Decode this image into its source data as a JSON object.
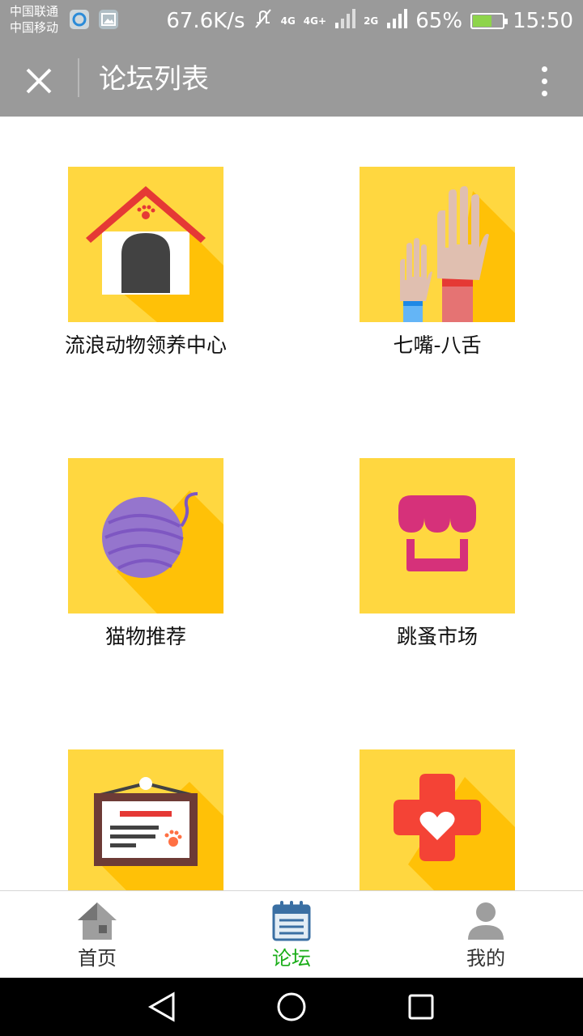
{
  "status_bar": {
    "carrier_1": "中国联通",
    "carrier_2": "中国移动",
    "speed": "67.6K/s",
    "net_4g": "4G",
    "net_4g_plus": "4G+",
    "net_2g": "2G",
    "battery": "65%",
    "battery_level": 0.65,
    "time": "15:50"
  },
  "app_bar": {
    "title": "论坛列表",
    "close_icon": "close-icon",
    "more_icon": "more-vert-icon"
  },
  "forums": [
    {
      "label": "流浪动物领养中心",
      "icon": "dog-house-icon"
    },
    {
      "label": "七嘴-八舌",
      "icon": "raised-hands-icon"
    },
    {
      "label": "猫物推荐",
      "icon": "yarn-ball-icon"
    },
    {
      "label": "跳蚤市场",
      "icon": "shop-awning-icon"
    },
    {
      "label": "",
      "icon": "notice-board-icon"
    },
    {
      "label": "",
      "icon": "medical-cross-heart-icon"
    }
  ],
  "tab_bar": {
    "tabs": [
      {
        "label": "首页",
        "icon": "home-icon",
        "active": false
      },
      {
        "label": "论坛",
        "icon": "notebook-icon",
        "active": true
      },
      {
        "label": "我的",
        "icon": "user-icon",
        "active": false
      }
    ],
    "active_color": "#1aad19"
  },
  "colors": {
    "tile_bg": "#ffd740",
    "tile_shadow": "#ffc107",
    "header_bg": "#9a9a9a"
  }
}
